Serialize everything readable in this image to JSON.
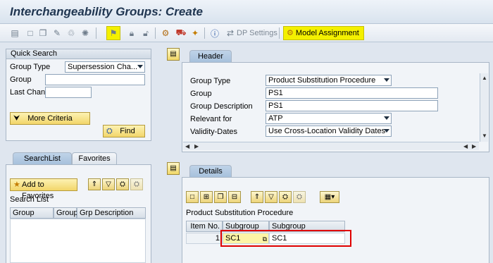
{
  "window": {
    "title": "Interchangeability Groups: Create"
  },
  "toolbar": {
    "dp_settings": "DP Settings",
    "model_assignment": "Model Assignment",
    "icons": [
      "table-icon",
      "new-doc-icon",
      "copy-icon",
      "edit-icon",
      "delete-icon",
      "network-icon",
      "flag-icon",
      "lock-icon",
      "unlock-icon",
      "hierarchy-icon",
      "transport-icon",
      "star-icon",
      "info-icon",
      "dp-icon",
      "model-icon"
    ]
  },
  "quick_search": {
    "title": "Quick Search",
    "group_type_label": "Group Type",
    "group_type_value": "Supersession Cha...",
    "group_label": "Group",
    "group_value": "",
    "last_change_label": "Last Change",
    "last_change_value": "",
    "more_criteria": "More Criteria",
    "find": "Find"
  },
  "search_tabs": {
    "searchlist": "SearchList",
    "favorites": "Favorites"
  },
  "search_list": {
    "add_to_favorites": "Add to Favorites",
    "title": "Search List",
    "columns": [
      "Group Type",
      "Group",
      "Grp Description"
    ]
  },
  "header_tab": {
    "label": "Header"
  },
  "header": {
    "group_type_label": "Group Type",
    "group_type_value": "Product Substitution Procedure",
    "group_label": "Group",
    "group_value": "PS1",
    "group_description_label": "Group Description",
    "group_description_value": "PS1",
    "relevant_for_label": "Relevant for",
    "relevant_for_value": "ATP",
    "validity_dates_label": "Validity-Dates",
    "validity_dates_value": "Use Cross-Location Validity Dates"
  },
  "details_tab": {
    "label": "Details"
  },
  "details": {
    "procedure_title": "Product Substitution Procedure",
    "columns": [
      "Item No.",
      "Subgroup",
      "Subgroup Description"
    ],
    "rows": [
      {
        "item_no": "1",
        "subgroup": "SC1",
        "subgroup_description": "SC1"
      }
    ]
  },
  "colors": {
    "highlight": "#f4f000",
    "accent": "#1f3550",
    "red_box": "#e00000"
  }
}
